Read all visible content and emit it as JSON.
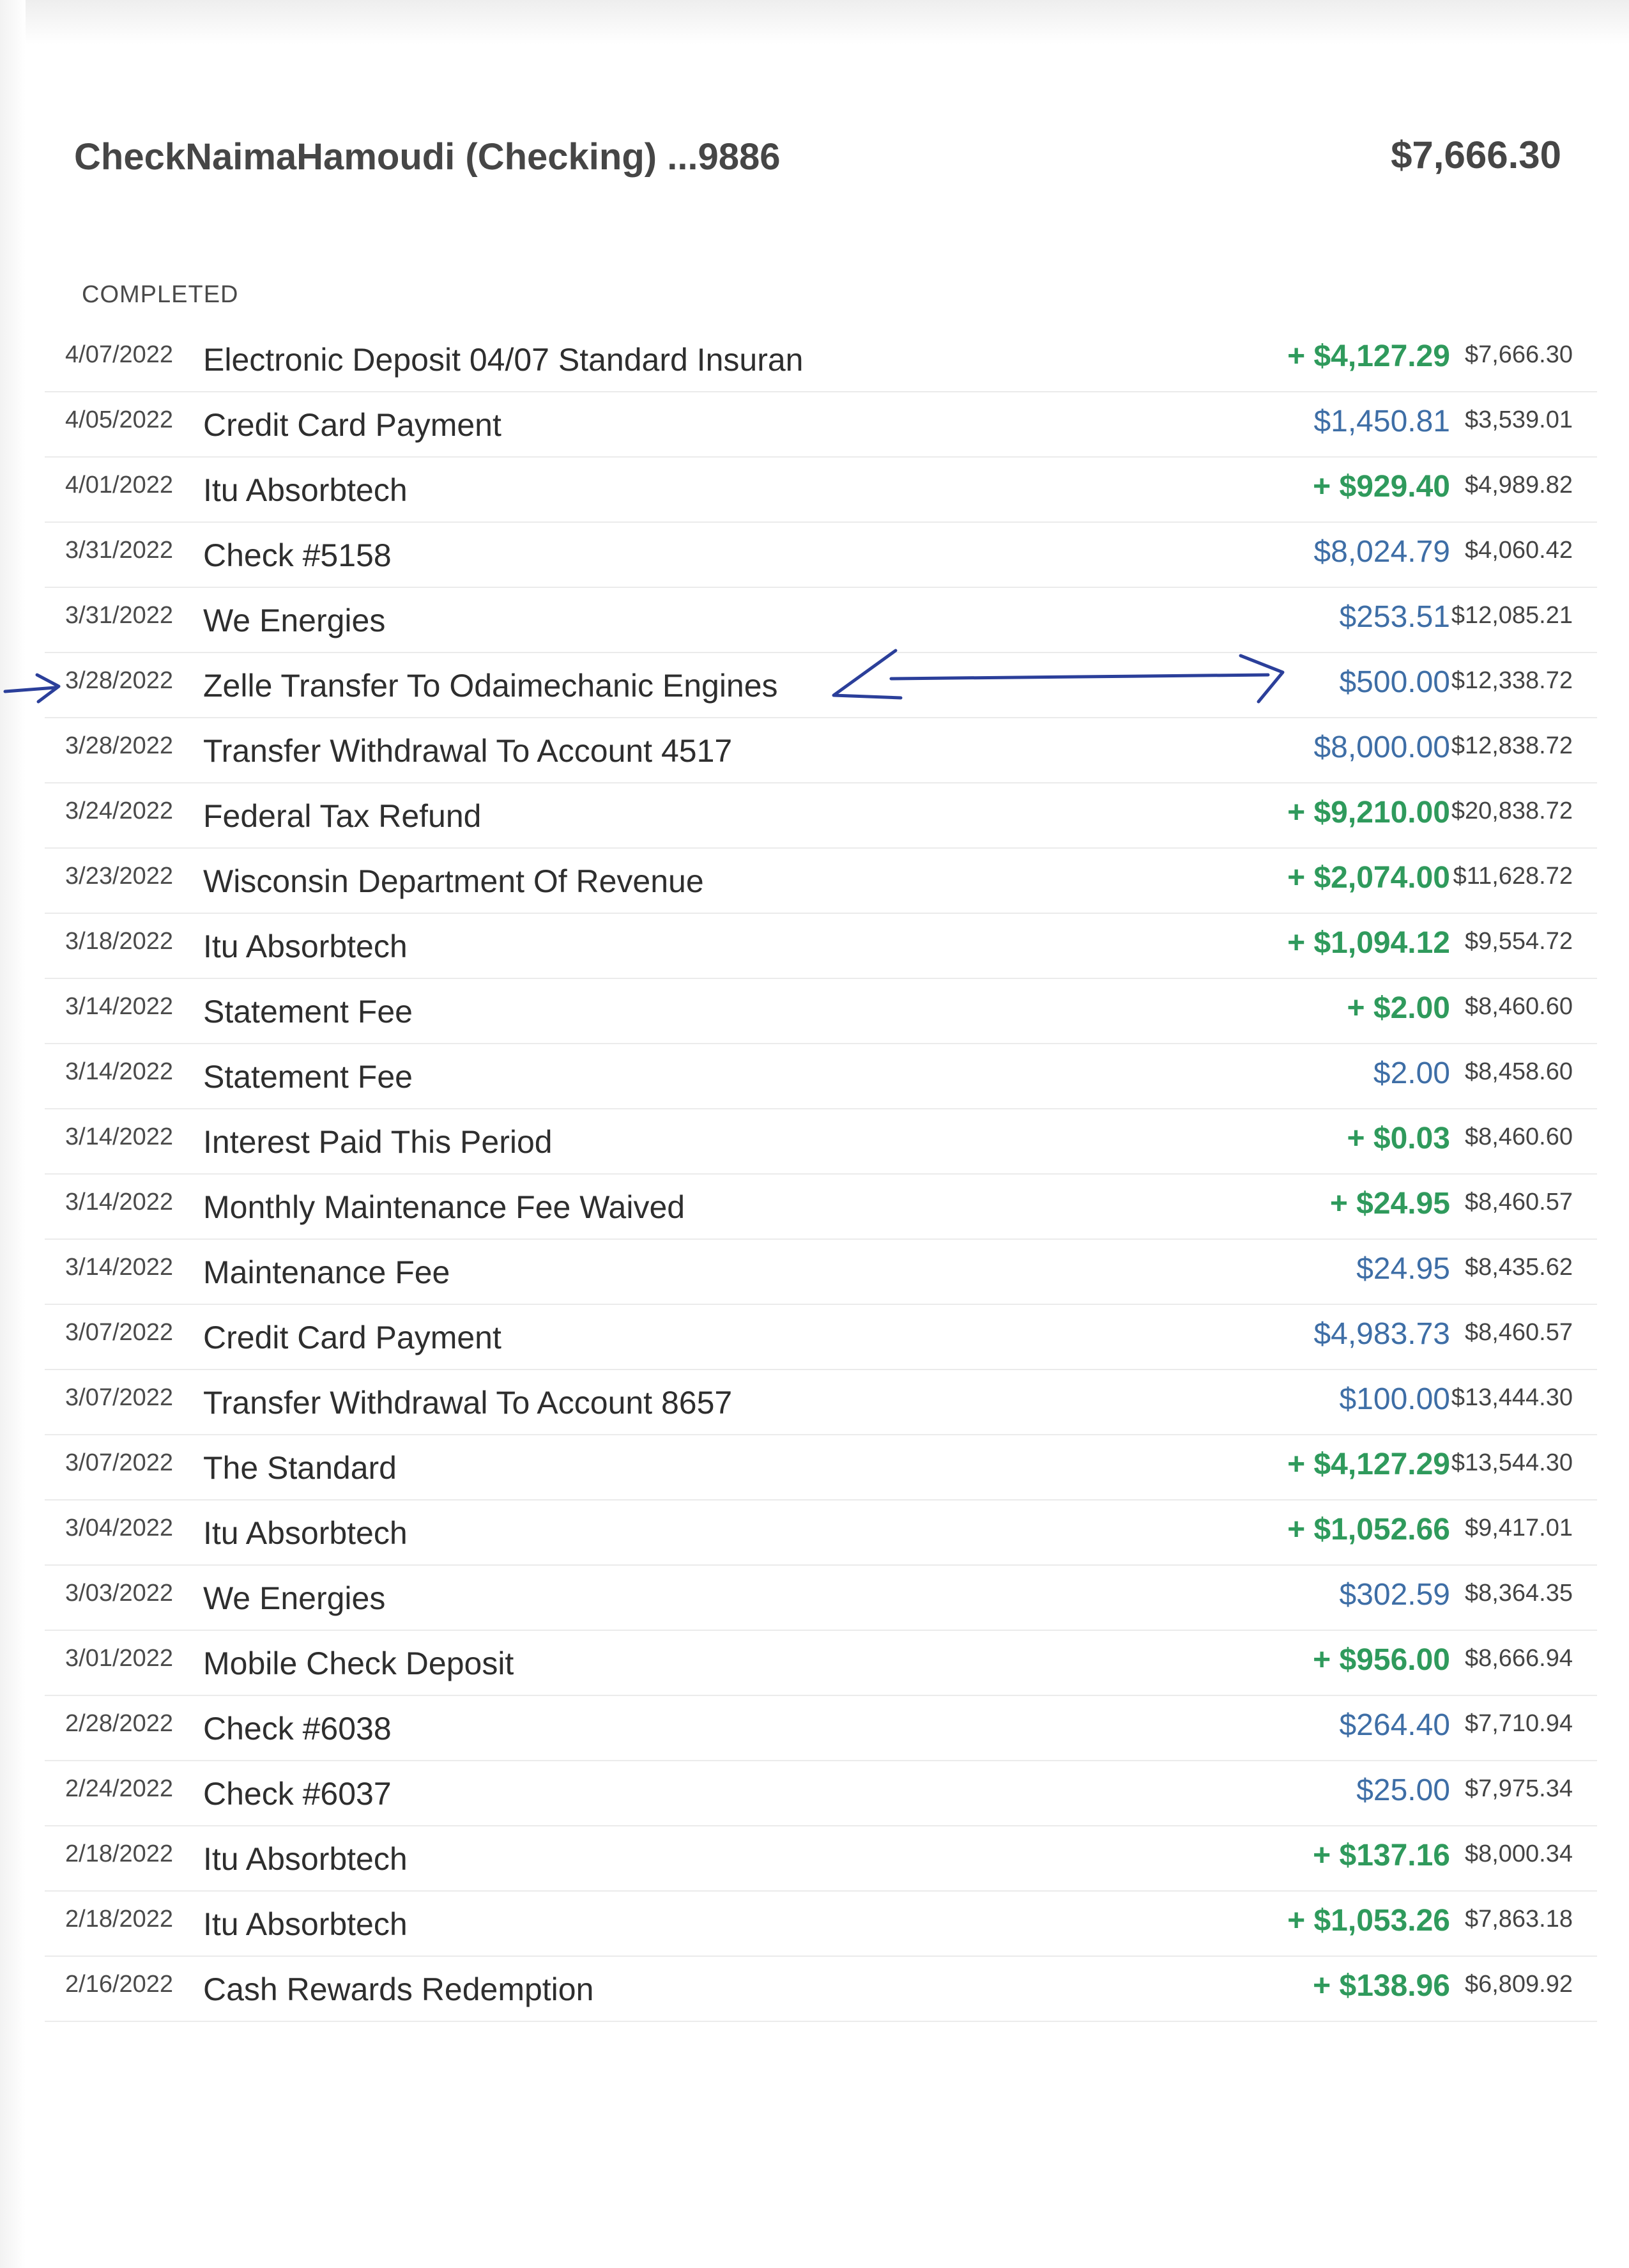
{
  "account": {
    "title": "CheckNaimaHamoudi (Checking) ...9886",
    "balance": "$7,666.30"
  },
  "section_label": "COMPLETED",
  "transactions": [
    {
      "date": "4/07/2022",
      "description": "Electronic Deposit 04/07 Standard Insuran",
      "amount": "+ $4,127.29",
      "type": "credit",
      "balance": "$7,666.30"
    },
    {
      "date": "4/05/2022",
      "description": "Credit Card Payment",
      "amount": "$1,450.81",
      "type": "debit",
      "balance": "$3,539.01"
    },
    {
      "date": "4/01/2022",
      "description": "Itu Absorbtech",
      "amount": "+ $929.40",
      "type": "credit",
      "balance": "$4,989.82"
    },
    {
      "date": "3/31/2022",
      "description": "Check #5158",
      "amount": "$8,024.79",
      "type": "debit",
      "balance": "$4,060.42"
    },
    {
      "date": "3/31/2022",
      "description": "We Energies",
      "amount": "$253.51",
      "type": "debit",
      "balance": "$12,085.21"
    },
    {
      "date": "3/28/2022",
      "description": "Zelle Transfer To Odaimechanic Engines",
      "amount": "$500.00",
      "type": "debit",
      "balance": "$12,338.72"
    },
    {
      "date": "3/28/2022",
      "description": "Transfer Withdrawal To Account 4517",
      "amount": "$8,000.00",
      "type": "debit",
      "balance": "$12,838.72"
    },
    {
      "date": "3/24/2022",
      "description": "Federal Tax Refund",
      "amount": "+ $9,210.00",
      "type": "credit",
      "balance": "$20,838.72"
    },
    {
      "date": "3/23/2022",
      "description": "Wisconsin Department Of Revenue",
      "amount": "+ $2,074.00",
      "type": "credit",
      "balance": "$11,628.72"
    },
    {
      "date": "3/18/2022",
      "description": "Itu Absorbtech",
      "amount": "+ $1,094.12",
      "type": "credit",
      "balance": "$9,554.72"
    },
    {
      "date": "3/14/2022",
      "description": "Statement Fee",
      "amount": "+ $2.00",
      "type": "credit",
      "balance": "$8,460.60"
    },
    {
      "date": "3/14/2022",
      "description": "Statement Fee",
      "amount": "$2.00",
      "type": "debit",
      "balance": "$8,458.60"
    },
    {
      "date": "3/14/2022",
      "description": "Interest Paid This Period",
      "amount": "+ $0.03",
      "type": "credit",
      "balance": "$8,460.60"
    },
    {
      "date": "3/14/2022",
      "description": "Monthly Maintenance Fee Waived",
      "amount": "+ $24.95",
      "type": "credit",
      "balance": "$8,460.57"
    },
    {
      "date": "3/14/2022",
      "description": "Maintenance Fee",
      "amount": "$24.95",
      "type": "debit",
      "balance": "$8,435.62"
    },
    {
      "date": "3/07/2022",
      "description": "Credit Card Payment",
      "amount": "$4,983.73",
      "type": "debit",
      "balance": "$8,460.57"
    },
    {
      "date": "3/07/2022",
      "description": "Transfer Withdrawal To Account 8657",
      "amount": "$100.00",
      "type": "debit",
      "balance": "$13,444.30"
    },
    {
      "date": "3/07/2022",
      "description": "The Standard",
      "amount": "+ $4,127.29",
      "type": "credit",
      "balance": "$13,544.30"
    },
    {
      "date": "3/04/2022",
      "description": "Itu Absorbtech",
      "amount": "+ $1,052.66",
      "type": "credit",
      "balance": "$9,417.01"
    },
    {
      "date": "3/03/2022",
      "description": "We Energies",
      "amount": "$302.59",
      "type": "debit",
      "balance": "$8,364.35"
    },
    {
      "date": "3/01/2022",
      "description": "Mobile Check Deposit",
      "amount": "+ $956.00",
      "type": "credit",
      "balance": "$8,666.94"
    },
    {
      "date": "2/28/2022",
      "description": "Check #6038",
      "amount": "$264.40",
      "type": "debit",
      "balance": "$7,710.94"
    },
    {
      "date": "2/24/2022",
      "description": "Check #6037",
      "amount": "$25.00",
      "type": "debit",
      "balance": "$7,975.34"
    },
    {
      "date": "2/18/2022",
      "description": "Itu Absorbtech",
      "amount": "+ $137.16",
      "type": "credit",
      "balance": "$8,000.34"
    },
    {
      "date": "2/18/2022",
      "description": "Itu Absorbtech",
      "amount": "+ $1,053.26",
      "type": "credit",
      "balance": "$7,863.18"
    },
    {
      "date": "2/16/2022",
      "description": "Cash Rewards Redemption",
      "amount": "+ $138.96",
      "type": "credit",
      "balance": "$6,809.92"
    }
  ],
  "colors": {
    "credit": "#2f9a5c",
    "debit": "#3e6ea6",
    "ink": "#2b3f9a"
  },
  "annotations": {
    "handwritten_arrows": [
      "left-pointer-arrow",
      "double-headed-arrow"
    ],
    "highlighted_row_index": 5
  }
}
